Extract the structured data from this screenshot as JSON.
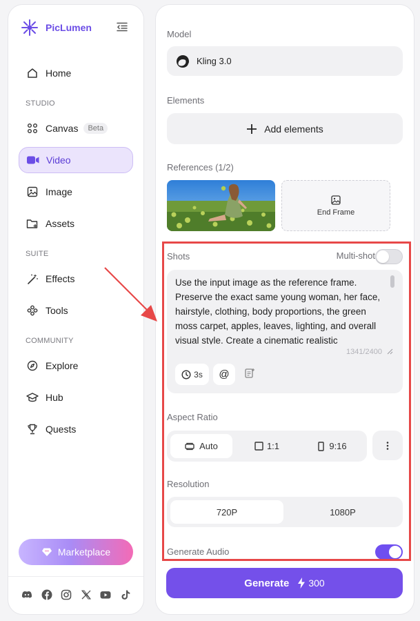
{
  "brand": {
    "name": "PicLumen",
    "accent": "#6b4de6"
  },
  "sidebar": {
    "items": [
      {
        "label": "Home",
        "icon": "home-icon"
      },
      {
        "label": "Canvas",
        "icon": "canvas-icon",
        "badge": "Beta"
      },
      {
        "label": "Video",
        "icon": "video-icon",
        "active": true
      },
      {
        "label": "Image",
        "icon": "image-icon"
      },
      {
        "label": "Assets",
        "icon": "assets-folder-icon"
      },
      {
        "label": "Effects",
        "icon": "magic-wand-icon"
      },
      {
        "label": "Tools",
        "icon": "tools-icon"
      },
      {
        "label": "Explore",
        "icon": "compass-icon"
      },
      {
        "label": "Hub",
        "icon": "graduation-cap-icon"
      },
      {
        "label": "Quests",
        "icon": "trophy-icon"
      }
    ],
    "sections": {
      "studio": "STUDIO",
      "suite": "SUITE",
      "community": "COMMUNITY"
    },
    "marketplace_label": "Marketplace",
    "socials": [
      "discord-icon",
      "facebook-icon",
      "instagram-icon",
      "x-icon",
      "youtube-icon",
      "tiktok-icon"
    ]
  },
  "panel": {
    "model_label": "Model",
    "model_value": "Kling 3.0",
    "elements_label": "Elements",
    "add_elements": "Add elements",
    "references_label": "References (1/2)",
    "end_frame": "End Frame",
    "shots_label": "Shots",
    "multishot_label": "Multi-shot",
    "multishot_enabled": false,
    "prompt": "Use the input image as the reference frame. Preserve the exact same young woman, her face, hairstyle, clothing, body proportions, the green moss carpet, apples, leaves, lighting, and overall visual style. Create a cinematic realistic",
    "char_count": "1341/2400",
    "duration": "3s",
    "mention_symbol": "@",
    "aspect_label": "Aspect Ratio",
    "aspect_options": [
      "Auto",
      "1:1",
      "9:16"
    ],
    "aspect_selected": "Auto",
    "resolution_label": "Resolution",
    "resolution_options": [
      "720P",
      "1080P"
    ],
    "resolution_selected": "720P",
    "audio_label": "Generate Audio",
    "audio_enabled": true,
    "generate_label": "Generate",
    "generate_cost": "300",
    "generate_color": "#7450ea",
    "highlight_color": "#e74848"
  }
}
